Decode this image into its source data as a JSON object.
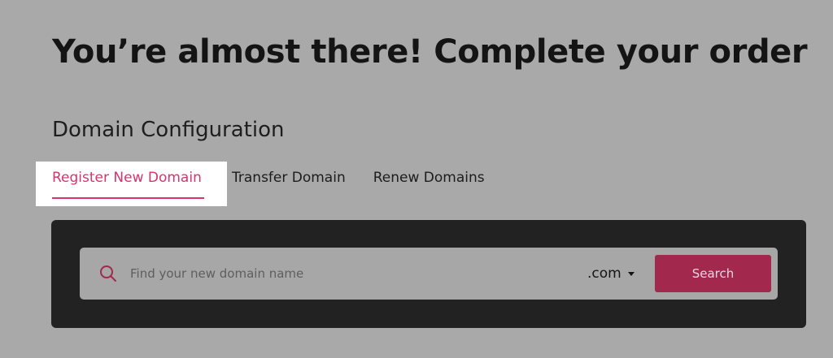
{
  "page": {
    "headline": "You’re almost there! Complete your order",
    "section_title": "Domain Configuration"
  },
  "tabs": [
    {
      "label": "Register New Domain",
      "active": true
    },
    {
      "label": "Transfer Domain",
      "active": false
    },
    {
      "label": "Renew Domains",
      "active": false
    }
  ],
  "search": {
    "icon": "search-icon",
    "placeholder": "Find your new domain name",
    "value": "",
    "tld_selected": ".com",
    "button_label": "Search"
  },
  "colors": {
    "overlay_background": "#a9a9a9",
    "accent": "#d8336d",
    "panel": "#222222",
    "search_button": "#a3284e"
  }
}
